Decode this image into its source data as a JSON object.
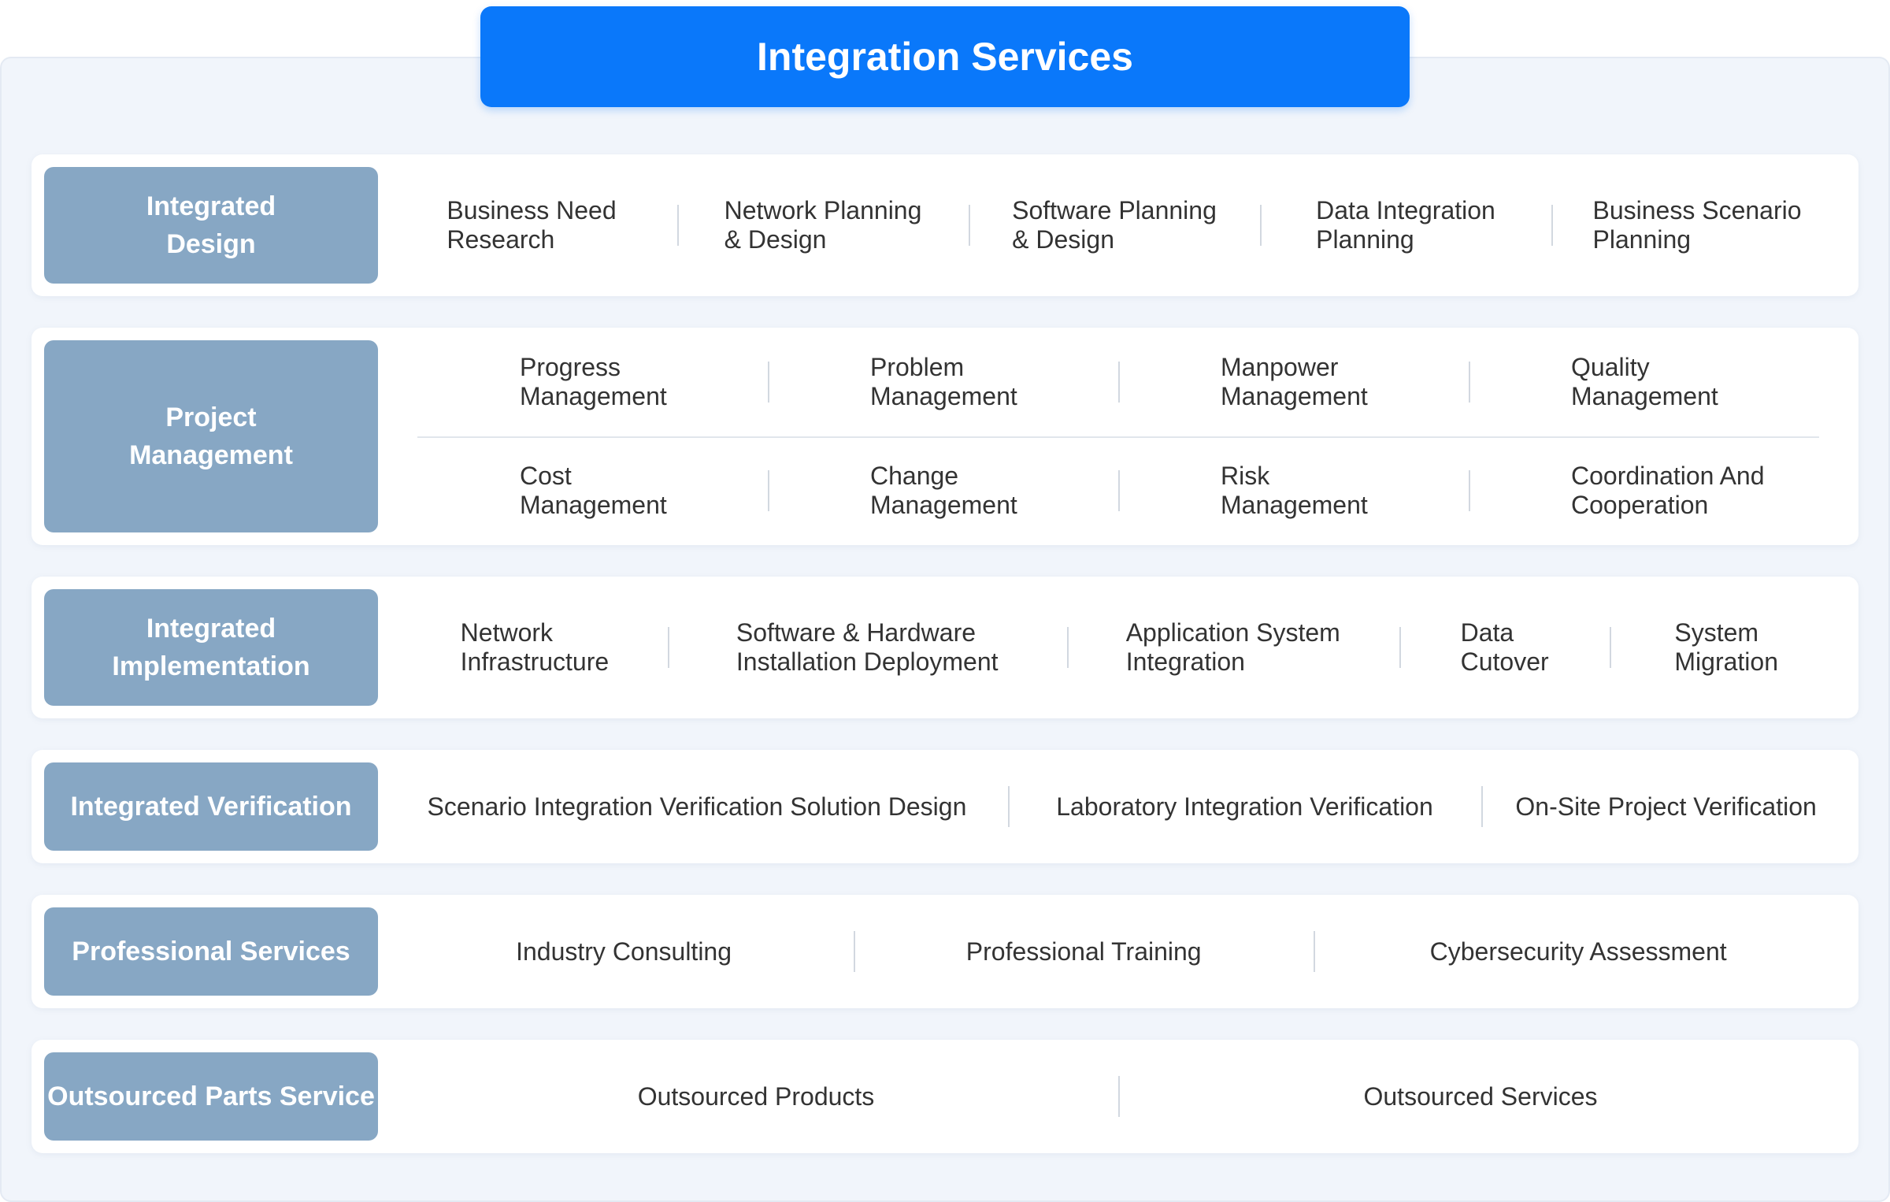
{
  "title": "Integration Services",
  "rows": [
    {
      "label": "Integrated\nDesign",
      "items": [
        "Business Need\nResearch",
        "Network Planning\n& Design",
        "Software Planning\n& Design",
        "Data Integration\nPlanning",
        "Business Scenario\nPlanning"
      ]
    },
    {
      "label": "Project\nManagement",
      "grid": [
        [
          "Progress\nManagement",
          "Problem\nManagement",
          "Manpower\nManagement",
          "Quality\nManagement"
        ],
        [
          "Cost\nManagement",
          "Change\nManagement",
          "Risk\nManagement",
          "Coordination And\nCooperation"
        ]
      ]
    },
    {
      "label": "Integrated\nImplementation",
      "items": [
        "Network\nInfrastructure",
        "Software & Hardware\nInstallation  Deployment",
        "Application System\nIntegration",
        "Data\nCutover",
        "System\nMigration"
      ]
    },
    {
      "label": "Integrated Verification",
      "items": [
        "Scenario Integration Verification Solution Design",
        "Laboratory Integration Verification",
        "On-Site Project Verification"
      ]
    },
    {
      "label": "Professional Services",
      "items": [
        "Industry Consulting",
        "Professional Training",
        "Cybersecurity Assessment"
      ]
    },
    {
      "label": "Outsourced Parts Service",
      "items": [
        "Outsourced Products",
        "Outsourced Services"
      ]
    }
  ],
  "colors": {
    "title_bg": "#0a78fa",
    "label_bg": "#87a7c4",
    "panel_bg": "#f1f5fb",
    "row_bg": "#ffffff"
  }
}
